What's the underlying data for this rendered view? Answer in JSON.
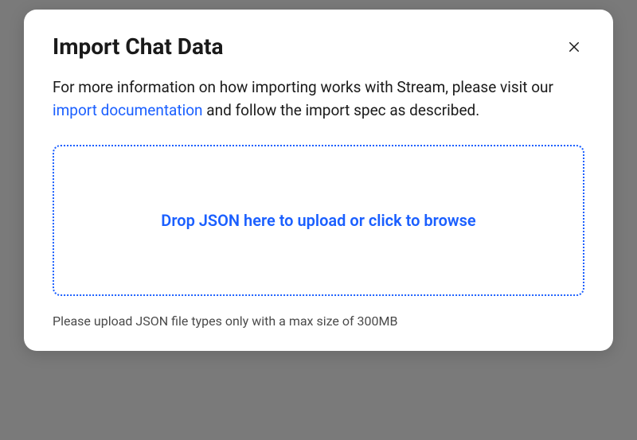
{
  "modal": {
    "title": "Import Chat Data",
    "description_before": "For more information on how importing works with Stream, please visit our ",
    "link_text": "import documentation",
    "description_after": " and follow the import spec as described.",
    "dropzone_text": "Drop JSON here to upload or click to browse",
    "helper_text": "Please upload JSON file types only with a max size of 300MB"
  }
}
